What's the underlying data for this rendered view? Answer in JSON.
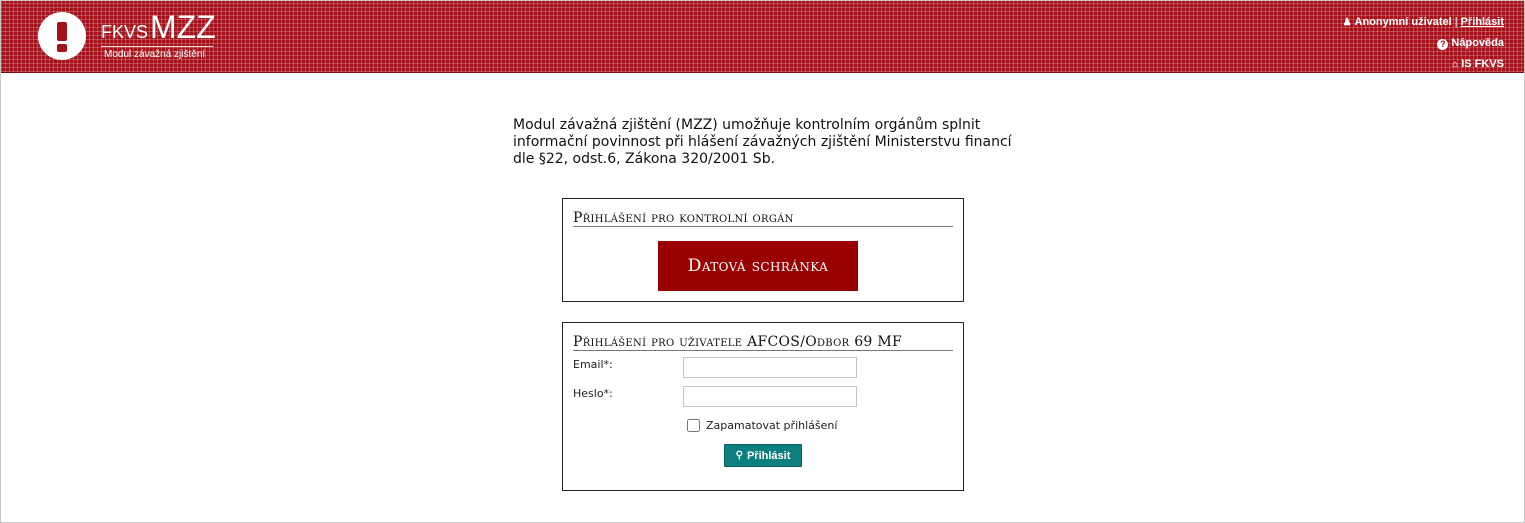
{
  "header": {
    "brand_prefix": "FKVS",
    "brand_main": "MZZ",
    "brand_subtitle": "Modul závažná zjištění",
    "user_label": "Anonymní uživatel",
    "separator": "|",
    "login_link": "Přihlásit",
    "help_link": "Nápověda",
    "is_fkvs_link": "IS FKVS",
    "background_color": "#a3121a"
  },
  "intro": {
    "text": "Modul závažná zjištění (MZZ) umožňuje kontrolním orgánům splnit informační povinnost při hlášení závažných zjištění Ministerstvu financí dle §22, odst.6, Zákona 320/2001 Sb."
  },
  "control_body_login": {
    "title": "Přihlášení pro kontrolní orgán",
    "data_box_button": "Datová schránka",
    "button_color": "#990000"
  },
  "afcos_login": {
    "title": "Přihlášení pro uživatele AFCOS/Odbor 69 MF",
    "email_label": "Email*:",
    "email_value": "",
    "password_label": "Heslo*:",
    "password_value": "",
    "remember_label": "Zapamatovat přihlášení",
    "remember_checked": false,
    "submit_label": "Přihlásit",
    "submit_color": "#0e7f7f"
  },
  "icons": {
    "logo": "exclamation-icon",
    "user": "user-icon",
    "help": "question-circle-icon",
    "home": "home-icon",
    "key": "key-icon"
  }
}
